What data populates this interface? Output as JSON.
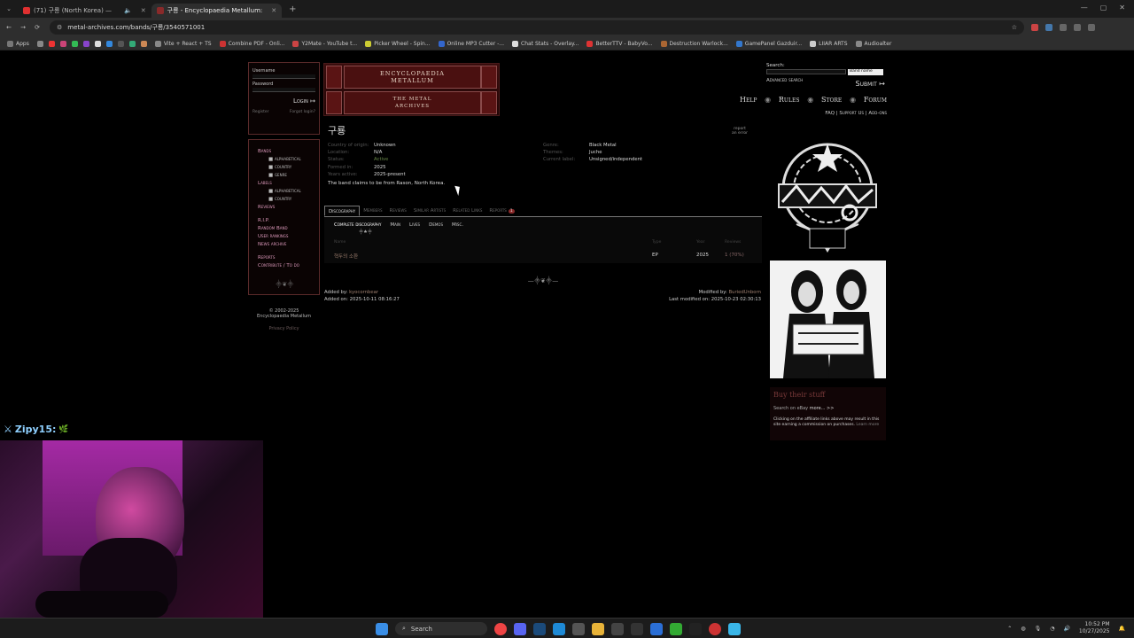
{
  "browser": {
    "tabs": [
      {
        "label": "(71) 구룡 (North Korea) —",
        "color": "#e03030"
      },
      {
        "label": "구룡 - Encyclopaedia Metallum:",
        "color": "#8a2a2a"
      }
    ],
    "url": "metal-archives.com/bands/구룡/3540571001",
    "bookmarks": [
      {
        "label": "Apps",
        "color": "#777"
      },
      {
        "label": "Vite + React + TS",
        "color": "#888"
      },
      {
        "label": "Combine PDF - Onli...",
        "color": "#c33"
      },
      {
        "label": "Y2Mate - YouTube t...",
        "color": "#c44"
      },
      {
        "label": "Picker Wheel - Spin...",
        "color": "#cc3"
      },
      {
        "label": "Online MP3 Cutter -...",
        "color": "#36c"
      },
      {
        "label": "Chat Stats - Overlay...",
        "color": "#ddd"
      },
      {
        "label": "BetterTTV - BabyVo...",
        "color": "#d33"
      },
      {
        "label": "Destruction Warlock...",
        "color": "#a63"
      },
      {
        "label": "GamePanel Gazduir...",
        "color": "#37c"
      },
      {
        "label": "LIIAR ARTS",
        "color": "#ccc"
      },
      {
        "label": "Audioalter",
        "color": "#888"
      }
    ]
  },
  "login": {
    "username_label": "Username",
    "password_label": "Password",
    "login_button": "Login",
    "register": "Register",
    "forgot": "Forgot login?"
  },
  "menu": {
    "bands": "Bands",
    "bands_alpha": "alphabetical",
    "bands_country": "country",
    "bands_genre": "genre",
    "labels": "Labels",
    "labels_alpha": "alphabetical",
    "labels_country": "country",
    "reviews": "Reviews",
    "rip": "R.I.P.",
    "random_band": "Random Band",
    "user_rankings": "User rankings",
    "news_archive": "News archive",
    "reports": "Reports",
    "contribute": "Contribute / To do"
  },
  "footer": {
    "copy1": "© 2002-2025",
    "copy2": "Encyclopaedia Metallum",
    "privacy": "Privacy Policy"
  },
  "logo": {
    "line1": "ENCYCLOPAEDIA",
    "line2": "METALLUM",
    "line3": "THE METAL",
    "line4": "ARCHIVES"
  },
  "search": {
    "label": "Search:",
    "select_value": "Band name",
    "advanced": "Advanced search",
    "submit": "Submit"
  },
  "nav": {
    "help": "Help",
    "rules": "Rules",
    "store": "Store",
    "forum": "Forum",
    "faq": "FAQ",
    "support": "Support Us",
    "addons": "Add-ons"
  },
  "band": {
    "name": "구룡",
    "report": "report",
    "report2": "an error",
    "country_k": "Country of origin:",
    "country_v": "Unknown",
    "location_k": "Location:",
    "location_v": "N/A",
    "status_k": "Status:",
    "status_v": "Active",
    "formed_k": "Formed in:",
    "formed_v": "2025",
    "years_k": "Years active:",
    "years_v": "2025-present",
    "genre_k": "Genre:",
    "genre_v": "Black Metal",
    "themes_k": "Themes:",
    "themes_v": "Juche",
    "label_k": "Current label:",
    "label_v": "Unsigned/independent",
    "note": "The band claims to be from Rason, North Korea."
  },
  "tabs": {
    "discography": "Discography",
    "members": "Members",
    "reviews": "Reviews",
    "similar": "Similar Artists",
    "related": "Related Links",
    "reports": "Reports",
    "reports_count": "1"
  },
  "subtabs": {
    "complete": "Complete discography",
    "main": "Main",
    "lives": "Lives",
    "demos": "Demos",
    "misc": "Misc."
  },
  "table": {
    "headers": {
      "name": "Name",
      "type": "Type",
      "year": "Year",
      "reviews": "Reviews"
    },
    "rows": [
      {
        "name": "혁두의 소환",
        "type": "EP",
        "year": "2025",
        "reviews": "1 (70%)"
      }
    ]
  },
  "meta": {
    "added_by_label": "Added by:",
    "added_by": "kyocornbear",
    "added_on": "Added on: 2025-10-11 08:16:27",
    "modified_by_label": "Modified by:",
    "modified_by": "BuriedUnborn",
    "modified_on": "Last modified on: 2025-10-23 02:30:13"
  },
  "sidebar_right": {
    "buy_title": "Buy their stuff",
    "search_on": "Search on eBay",
    "more": "more... >>",
    "disclaimer": "Clicking on the affiliate links above may result in this site earning a commission on purchases.",
    "learn_more": "Learn more"
  },
  "stream": {
    "chat_user": "Zipy15:",
    "chat_msg": "🌿"
  },
  "taskbar": {
    "search": "Search",
    "time": "10:52 PM",
    "date": "10/27/2025"
  }
}
